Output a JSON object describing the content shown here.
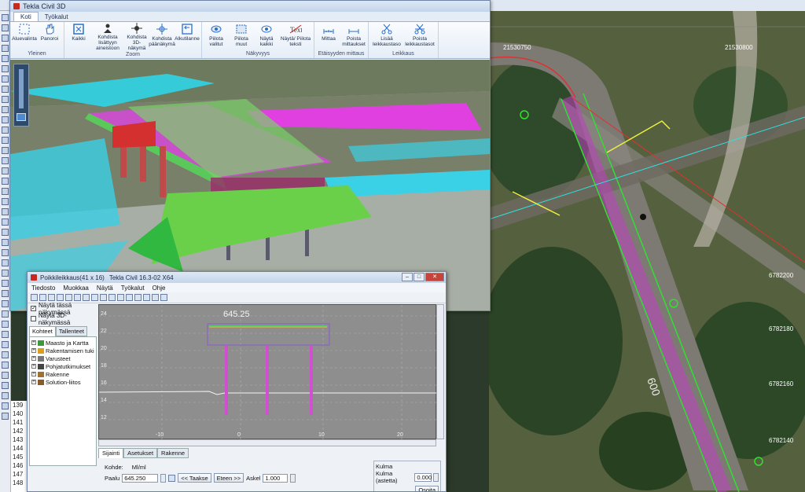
{
  "app": {
    "title": "Tekla Civil 3D",
    "tabs": [
      "Koti",
      "Työkalut"
    ]
  },
  "ribbon": {
    "groups": [
      {
        "label": "Yleinen",
        "buttons": [
          "Aluevalinta",
          "Panoroi"
        ]
      },
      {
        "label": "Zoom",
        "buttons": [
          "Kaikki",
          "Kohdista lisättyyn aineistoon",
          "Kohdista 3D-näkymä",
          "Kohdista päänäkymä",
          "Alkutilanne"
        ]
      },
      {
        "label": "Näkyvyys",
        "buttons": [
          "Piilota valitut",
          "Piilota muut",
          "Näytä kaikki",
          "Näytä/ Piilota teksti"
        ]
      },
      {
        "label": "Etäisyyden mittaus",
        "buttons": [
          "Mittaa",
          "Poista mittaukset"
        ]
      },
      {
        "label": "Leikkaus",
        "buttons": [
          "Lisää leikkaustaso",
          "Poista leikkaustasot"
        ]
      }
    ]
  },
  "cross_section": {
    "title": "Poikkileikkaus(41 x 16)",
    "version": "Tekla Civil 16.3-02 X64",
    "menu": [
      "Tiedosto",
      "Muokkaa",
      "Näytä",
      "Työkalut",
      "Ohje"
    ],
    "checkboxes": [
      {
        "label": "Näytä tässä näkymässä",
        "checked": true
      },
      {
        "label": "Näytä 3D-näkymässä",
        "checked": false
      }
    ],
    "panel_tabs": [
      "Kohteet",
      "Tallenteet"
    ],
    "tree": [
      "Maasto ja Kartta",
      "Rakentamisen tuki",
      "Varusteet",
      "Pohjatutkimukset",
      "Rakenne",
      "Solution-liitos"
    ],
    "plot": {
      "station_label": "645.25",
      "y_ticks": [
        "24",
        "22",
        "20",
        "18",
        "16",
        "14",
        "12"
      ],
      "x_ticks": [
        "-10",
        "0",
        "10",
        "20"
      ]
    },
    "bottom_tabs": [
      "Sijainti",
      "Asetukset",
      "Rakenne"
    ],
    "kohde_label": "Kohde:",
    "kohde_value": "Ml/ml",
    "paalu_label": "Paalu",
    "paalu_value": "645.250",
    "prev_button": "<< Taakse",
    "next_button": "Eteen >>",
    "askel_label": "Askel",
    "askel_value": "1.000",
    "kulma_group": "Kulma",
    "kulma_label": "Kulma (astetta)",
    "kulma_value": "0.000",
    "osoita_button": "Osoita"
  },
  "map": {
    "labels": [
      "21530750",
      "21530800",
      "6782200",
      "6782180",
      "6782160",
      "6782140",
      "600"
    ]
  },
  "background": {
    "left_numbers": [
      "139",
      "140",
      "141",
      "142",
      "143",
      "144",
      "145",
      "146",
      "147",
      "148"
    ]
  }
}
